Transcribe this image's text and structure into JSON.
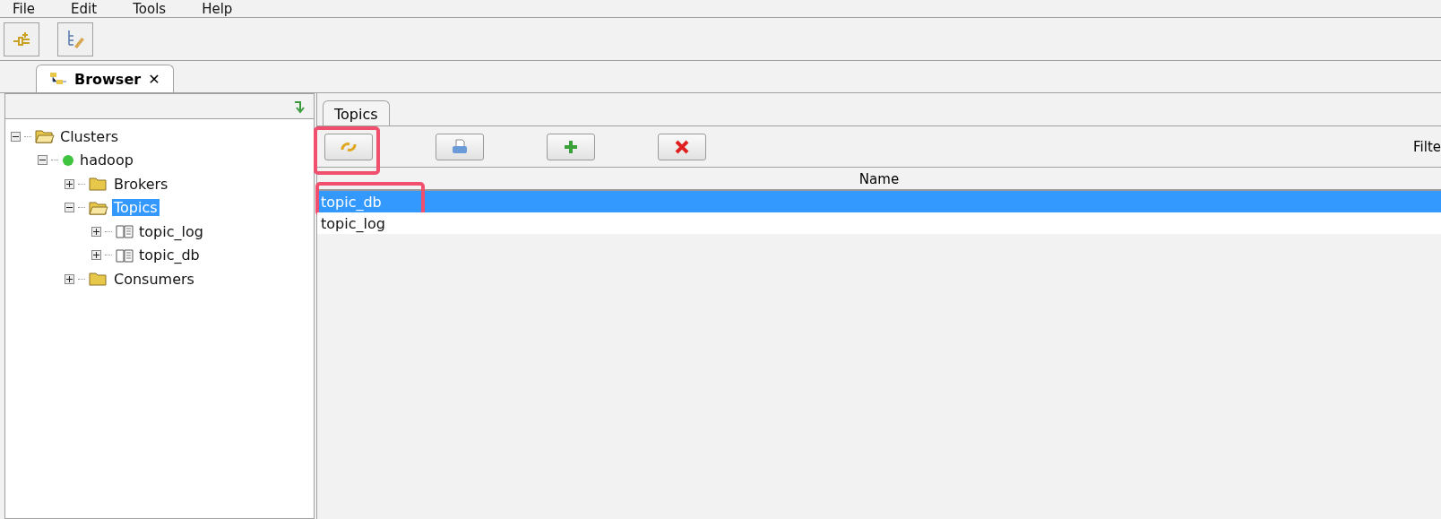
{
  "menu": [
    "File",
    "Edit",
    "Tools",
    "Help"
  ],
  "toolbar": [
    {
      "kind": "connect"
    },
    {
      "kind": "edit-tree"
    }
  ],
  "view_tab": {
    "label": "Browser",
    "close": "✕",
    "selected": true
  },
  "tree": [
    {
      "label": "Clusters",
      "kind": "folder",
      "expanded": true,
      "selected": false,
      "children": [
        {
          "label": "hadoop",
          "kind": "server",
          "expanded": true,
          "selected": false,
          "children": [
            {
              "label": "Brokers",
              "kind": "folder",
              "expanded": false,
              "selected": false
            },
            {
              "label": "Topics",
              "kind": "folder",
              "expanded": true,
              "selected": true,
              "children": [
                {
                  "label": "topic_log",
                  "kind": "topic",
                  "expanded": false,
                  "selected": false
                },
                {
                  "label": "topic_db",
                  "kind": "topic",
                  "expanded": false,
                  "selected": false
                }
              ]
            },
            {
              "label": "Consumers",
              "kind": "folder",
              "expanded": false,
              "selected": false
            }
          ]
        }
      ]
    }
  ],
  "detail_tab": {
    "label": "Topics",
    "selected": true
  },
  "actions": [
    {
      "kind": "refresh",
      "highlighted": true
    },
    {
      "kind": "print",
      "highlighted": false
    },
    {
      "kind": "add",
      "highlighted": false
    },
    {
      "kind": "delete",
      "highlighted": false
    }
  ],
  "filter_label": "Filte",
  "table": {
    "columns": [
      "Name"
    ],
    "rows": [
      {
        "cells": [
          "topic_db"
        ],
        "selected": true,
        "highlighted": true
      },
      {
        "cells": [
          "topic_log"
        ],
        "selected": false,
        "highlighted": false
      }
    ]
  }
}
